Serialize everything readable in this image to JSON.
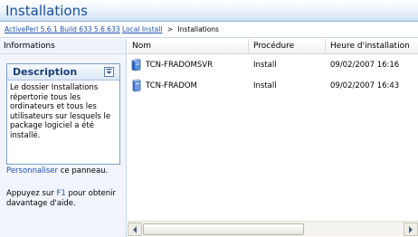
{
  "window": {
    "title": "Installations"
  },
  "breadcrumb": {
    "items": [
      "ActivePerl 5.6.1 Build 633 5.6.633",
      "Local Install"
    ],
    "separator": ">",
    "current": "Installations"
  },
  "sidebar": {
    "header": "Informations",
    "description": {
      "title": "Description",
      "text": "Le dossier Installations répertorie tous les ordinateurs et tous les utilisateurs sur lesquels le package logiciel a été installé."
    },
    "customize": {
      "link": "Personnaliser",
      "rest": " ce panneau."
    },
    "help": {
      "before": "Appuyez sur ",
      "key": "F1",
      "after": " pour obtenir davantage d'aide."
    }
  },
  "list": {
    "columns": [
      "Nom",
      "Procédure",
      "Heure d'installation"
    ],
    "rows": [
      {
        "icon": "server-icon",
        "name": "TCN-FRADOMSVR",
        "procedure": "Install",
        "time": "09/02/2007 16:16"
      },
      {
        "icon": "computer-icon",
        "name": "TCN-FRADOM",
        "procedure": "Install",
        "time": "09/02/2007 16:43"
      }
    ]
  },
  "colors": {
    "title": "#1b4f9a",
    "link": "#1f4fb0",
    "sidebar_bg": "#f1f5fb"
  }
}
